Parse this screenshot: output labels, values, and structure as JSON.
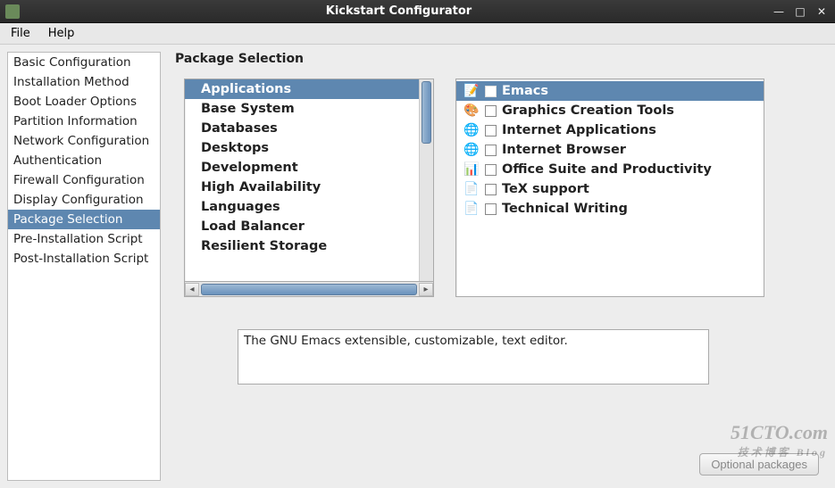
{
  "window": {
    "title": "Kickstart Configurator"
  },
  "menubar": {
    "items": [
      "File",
      "Help"
    ]
  },
  "sidebar": {
    "items": [
      "Basic Configuration",
      "Installation Method",
      "Boot Loader Options",
      "Partition Information",
      "Network Configuration",
      "Authentication",
      "Firewall Configuration",
      "Display Configuration",
      "Package Selection",
      "Pre-Installation Script",
      "Post-Installation Script"
    ],
    "selected_index": 8
  },
  "main": {
    "heading": "Package Selection",
    "categories": [
      "Applications",
      "Base System",
      "Databases",
      "Desktops",
      "Development",
      "High Availability",
      "Languages",
      "Load Balancer",
      "Resilient Storage"
    ],
    "categories_selected_index": 0,
    "packages": [
      {
        "icon": "emacs-icon",
        "glyph": "📝",
        "label": "Emacs",
        "checked": false
      },
      {
        "icon": "palette-icon",
        "glyph": "🎨",
        "label": "Graphics Creation Tools",
        "checked": false
      },
      {
        "icon": "globe-icon",
        "glyph": "🌐",
        "label": "Internet Applications",
        "checked": false
      },
      {
        "icon": "globe-icon",
        "glyph": "🌐",
        "label": "Internet Browser",
        "checked": false
      },
      {
        "icon": "office-icon",
        "glyph": "📊",
        "label": "Office Suite and Productivity",
        "checked": false
      },
      {
        "icon": "document-icon",
        "glyph": "📄",
        "label": "TeX support",
        "checked": false
      },
      {
        "icon": "document-icon",
        "glyph": "📄",
        "label": "Technical Writing",
        "checked": false
      }
    ],
    "packages_selected_index": 0,
    "description": "The GNU Emacs extensible, customizable, text editor.",
    "optional_button": "Optional packages"
  },
  "watermark": {
    "main": "51CTO.com",
    "sub": "技术博客  Blog"
  }
}
